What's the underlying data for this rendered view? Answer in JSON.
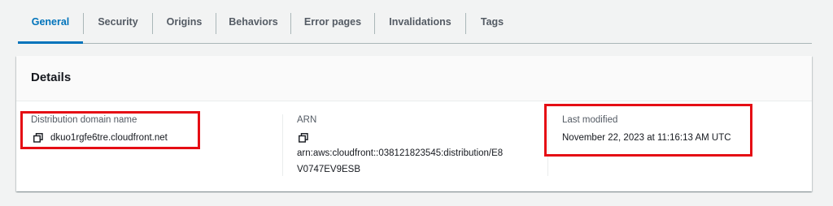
{
  "tabs": [
    {
      "label": "General",
      "active": true
    },
    {
      "label": "Security"
    },
    {
      "label": "Origins"
    },
    {
      "label": "Behaviors"
    },
    {
      "label": "Error pages"
    },
    {
      "label": "Invalidations"
    },
    {
      "label": "Tags"
    }
  ],
  "details": {
    "title": "Details",
    "domain": {
      "label": "Distribution domain name",
      "value": "dkuo1rgfe6tre.cloudfront.net",
      "icon": "copy-icon"
    },
    "arn": {
      "label": "ARN",
      "value_line1": "arn:aws:cloudfront::038121823545:distribution/E8",
      "value_line2": "V0747EV9ESB",
      "icon": "copy-icon"
    },
    "last_modified": {
      "label": "Last modified",
      "value": "November 22, 2023 at 11:16:13 AM UTC"
    }
  },
  "colors": {
    "accent": "#0073bb",
    "highlight": "#e50d14"
  }
}
